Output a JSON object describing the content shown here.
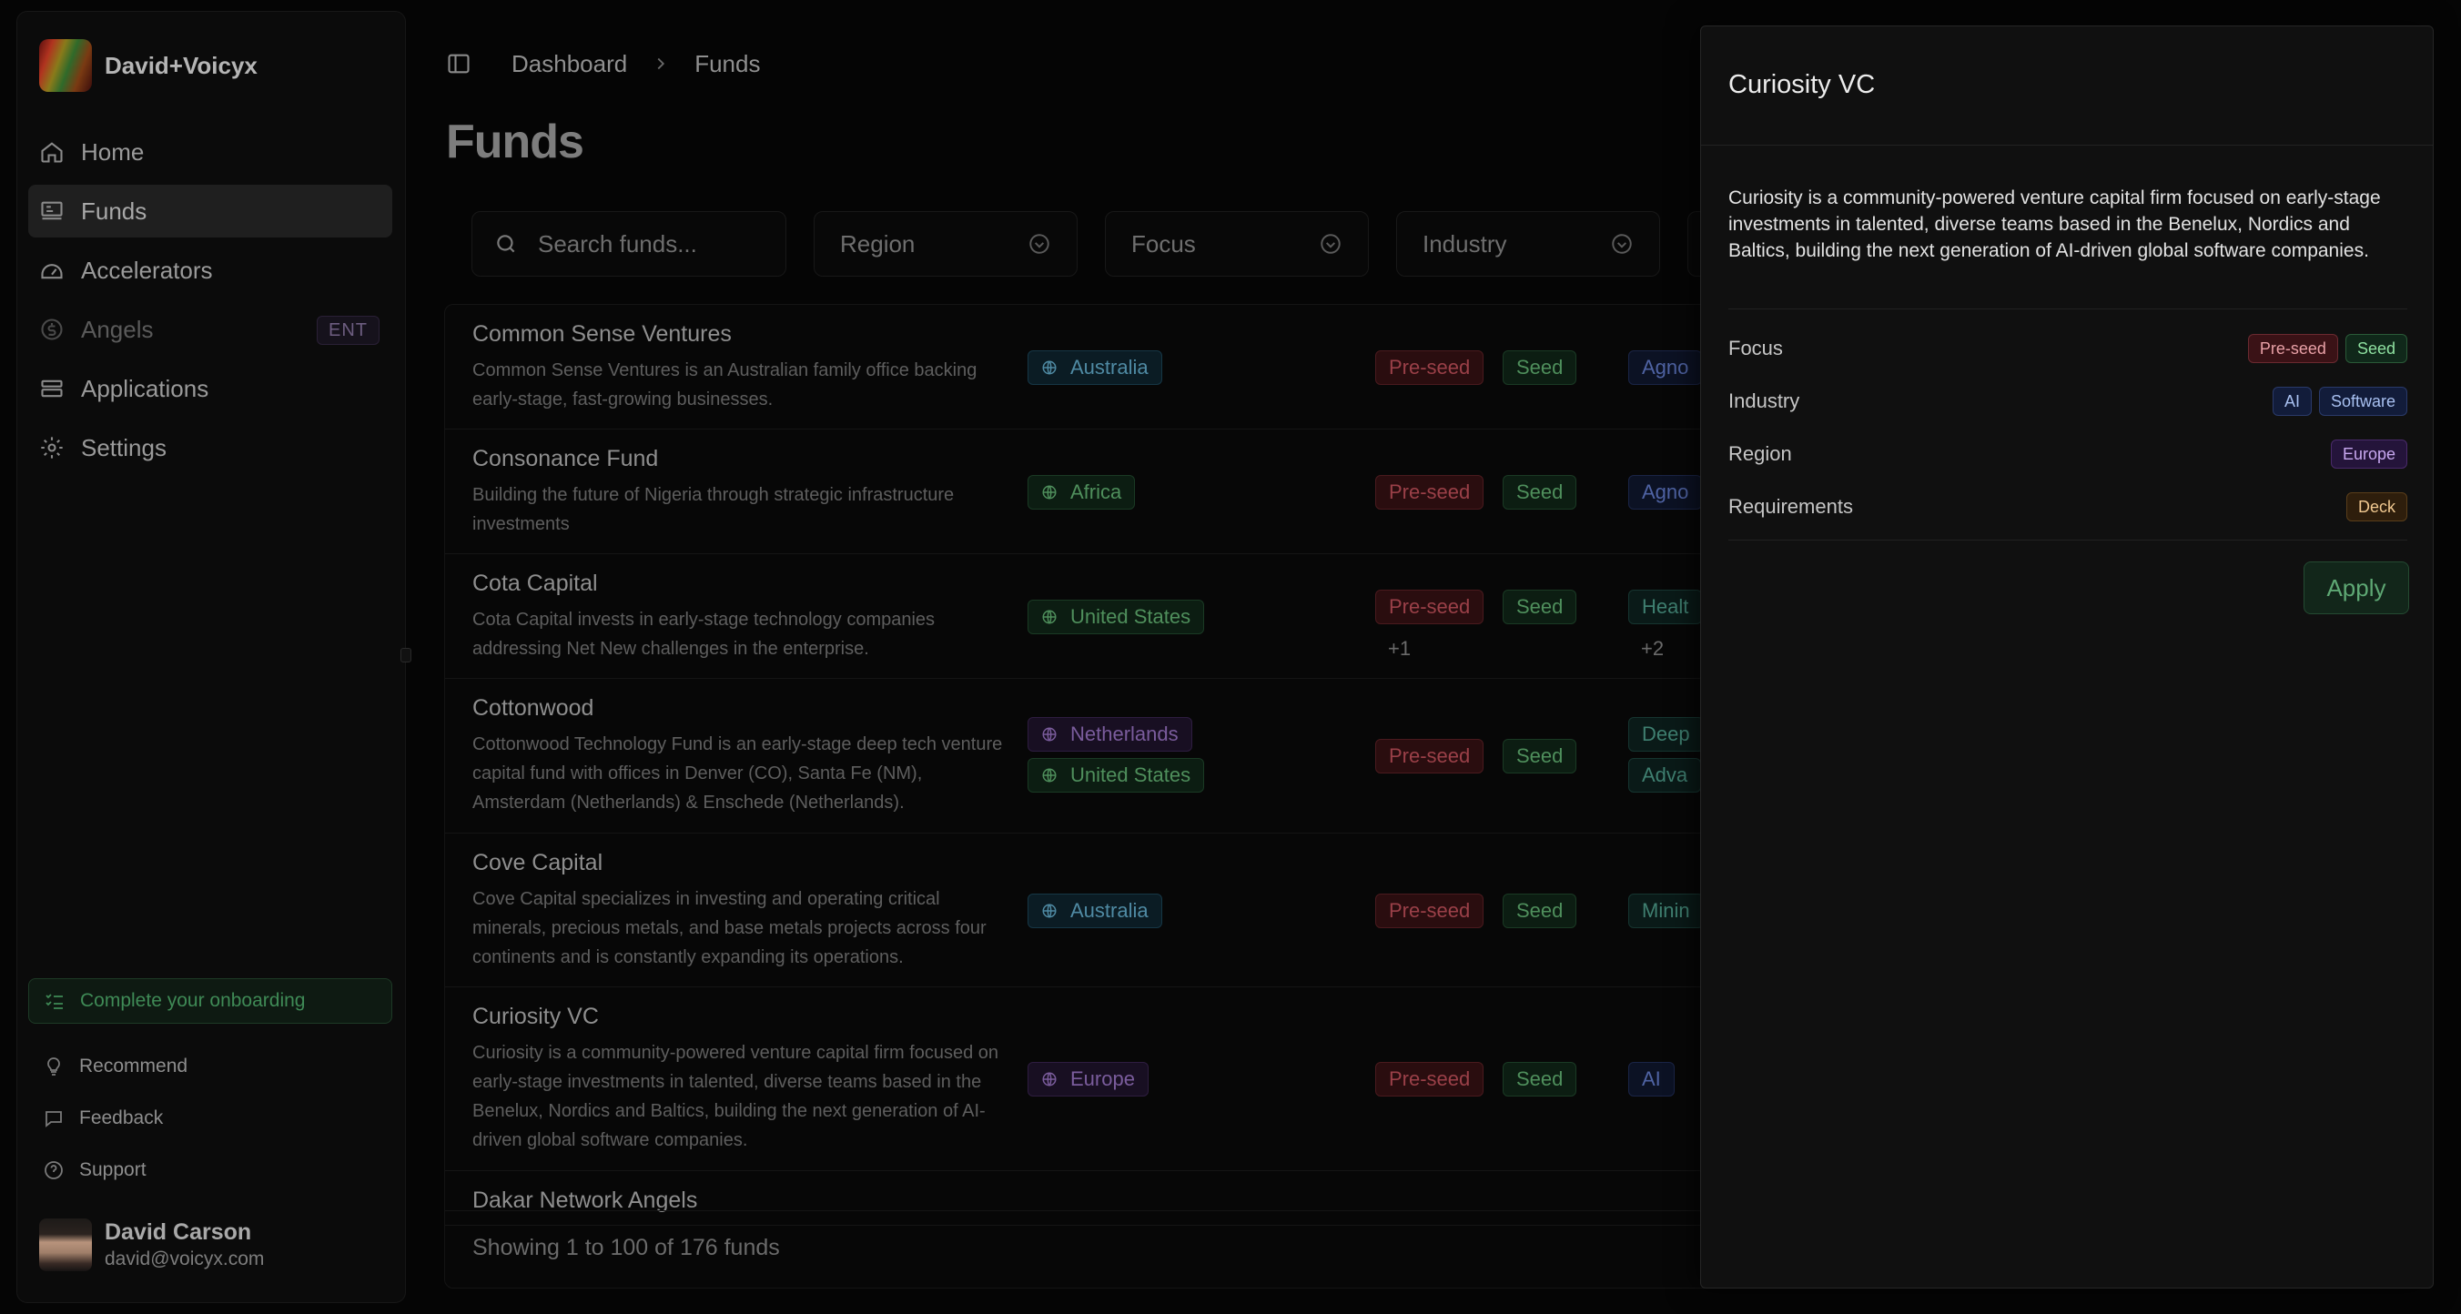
{
  "workspace": {
    "name": "David+Voicyx"
  },
  "nav": [
    {
      "label": "Home",
      "icon": "home-icon"
    },
    {
      "label": "Funds",
      "icon": "funds-icon"
    },
    {
      "label": "Accelerators",
      "icon": "accelerators-icon"
    },
    {
      "label": "Angels",
      "icon": "angels-icon",
      "badge": "ENT"
    },
    {
      "label": "Applications",
      "icon": "applications-icon"
    },
    {
      "label": "Settings",
      "icon": "gear-icon"
    }
  ],
  "onboarding": {
    "label": "Complete your onboarding"
  },
  "footer_links": [
    {
      "label": "Recommend",
      "icon": "lightbulb-icon"
    },
    {
      "label": "Feedback",
      "icon": "feedback-icon"
    },
    {
      "label": "Support",
      "icon": "help-icon"
    }
  ],
  "user": {
    "name": "David Carson",
    "email": "david@voicyx.com"
  },
  "breadcrumb": {
    "root": "Dashboard",
    "current": "Funds"
  },
  "page": {
    "title": "Funds"
  },
  "filters": {
    "search_placeholder": "Search funds...",
    "region": "Region",
    "focus": "Focus",
    "industry": "Industry"
  },
  "funds": [
    {
      "name": "Common Sense Ventures",
      "desc": "Common Sense Ventures is an Australian family office backing early-stage, fast-growing businesses.",
      "regions": [
        "Australia"
      ],
      "stages": [
        "Pre-seed",
        "Seed"
      ],
      "industries": [
        "Agno"
      ],
      "more_stages": "",
      "more_industries": ""
    },
    {
      "name": "Consonance Fund",
      "desc": "Building the future of Nigeria through strategic infrastructure investments",
      "regions": [
        "Africa"
      ],
      "stages": [
        "Pre-seed",
        "Seed"
      ],
      "industries": [
        "Agno"
      ],
      "more_stages": "",
      "more_industries": ""
    },
    {
      "name": "Cota Capital",
      "desc": "Cota Capital invests in early-stage technology companies addressing Net New challenges in the enterprise.",
      "regions": [
        "United States"
      ],
      "stages": [
        "Pre-seed",
        "Seed"
      ],
      "industries": [
        "Healt"
      ],
      "more_stages": "+1",
      "more_industries": "+2"
    },
    {
      "name": "Cottonwood",
      "desc": "Cottonwood Technology Fund is an early-stage deep tech venture capital fund with offices in Denver (CO), Santa Fe (NM), Amsterdam (Netherlands) & Enschede (Netherlands).",
      "regions": [
        "Netherlands",
        "United States"
      ],
      "stages": [
        "Pre-seed",
        "Seed"
      ],
      "industries": [
        "Deep",
        "Adva"
      ],
      "more_stages": "",
      "more_industries": ""
    },
    {
      "name": "Cove Capital",
      "desc": "Cove Capital specializes in investing and operating critical minerals, precious metals, and base metals projects across four continents and is constantly expanding its operations.",
      "regions": [
        "Australia"
      ],
      "stages": [
        "Pre-seed",
        "Seed"
      ],
      "industries": [
        "Minin"
      ],
      "more_stages": "",
      "more_industries": ""
    },
    {
      "name": "Curiosity VC",
      "desc": "Curiosity is a community-powered venture capital firm focused on early-stage investments in talented, diverse teams based in the Benelux, Nordics and Baltics, building the next generation of AI-driven global software companies.",
      "regions": [
        "Europe"
      ],
      "stages": [
        "Pre-seed",
        "Seed"
      ],
      "industries": [
        "AI"
      ],
      "more_stages": "",
      "more_industries": ""
    },
    {
      "name": "Dakar Network Angels",
      "desc": "",
      "regions": [],
      "stages": [],
      "industries": [],
      "more_stages": "",
      "more_industries": ""
    }
  ],
  "table_footer": "Showing 1 to 100 of 176 funds",
  "panel": {
    "title": "Curiosity VC",
    "description": "Curiosity is a community-powered venture capital firm focused on early-stage investments in talented, diverse teams based in the Benelux, Nordics and Baltics, building the next generation of AI-driven global software companies.",
    "rows": [
      {
        "label": "Focus",
        "tags": [
          "Pre-seed",
          "Seed"
        ]
      },
      {
        "label": "Industry",
        "tags": [
          "AI",
          "Software"
        ]
      },
      {
        "label": "Region",
        "tags": [
          "Europe"
        ]
      },
      {
        "label": "Requirements",
        "tags": [
          "Deck"
        ]
      }
    ],
    "apply_label": "Apply"
  },
  "colors": {
    "accent_green": "#4f8f5c",
    "accent_red": "#9a4048",
    "panel_bg": "#101010"
  }
}
